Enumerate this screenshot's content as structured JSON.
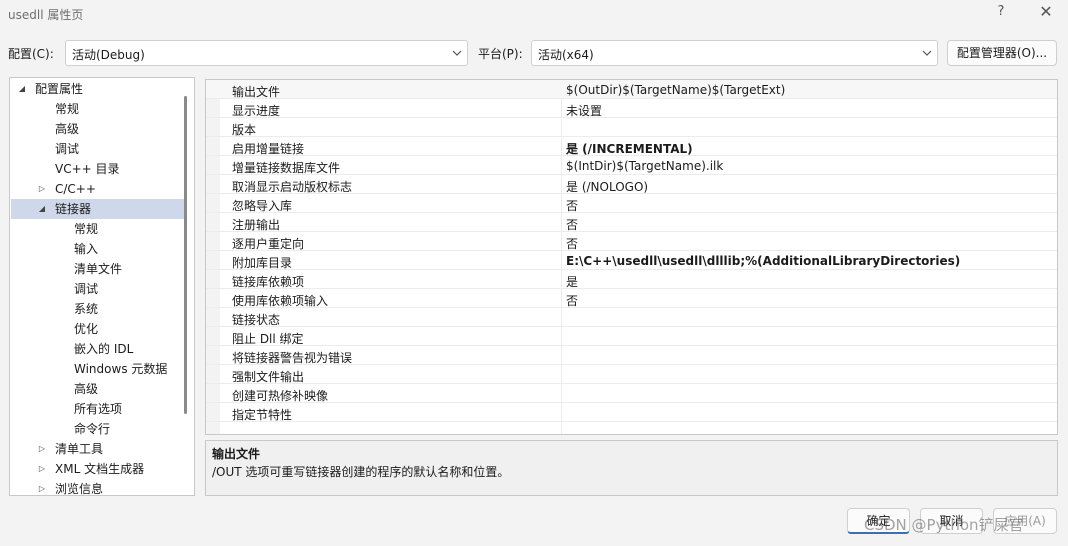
{
  "window": {
    "title": "usedll 属性页",
    "help_glyph": "?",
    "close_glyph": "✕"
  },
  "config_bar": {
    "config_label": "配置(C):",
    "config_value": "活动(Debug)",
    "platform_label": "平台(P):",
    "platform_value": "活动(x64)",
    "manager_button": "配置管理器(O)..."
  },
  "tree": {
    "items": [
      {
        "label": "配置属性",
        "expander": "◢",
        "level": 0
      },
      {
        "label": "常规",
        "expander": "",
        "level": 1
      },
      {
        "label": "高级",
        "expander": "",
        "level": 1
      },
      {
        "label": "调试",
        "expander": "",
        "level": 1
      },
      {
        "label": "VC++ 目录",
        "expander": "",
        "level": 1
      },
      {
        "label": "C/C++",
        "expander": "▷",
        "level": 1
      },
      {
        "label": "链接器",
        "expander": "◢",
        "level": 1,
        "selected": true
      },
      {
        "label": "常规",
        "expander": "",
        "level": 2
      },
      {
        "label": "输入",
        "expander": "",
        "level": 2
      },
      {
        "label": "清单文件",
        "expander": "",
        "level": 2
      },
      {
        "label": "调试",
        "expander": "",
        "level": 2
      },
      {
        "label": "系统",
        "expander": "",
        "level": 2
      },
      {
        "label": "优化",
        "expander": "",
        "level": 2
      },
      {
        "label": "嵌入的 IDL",
        "expander": "",
        "level": 2
      },
      {
        "label": "Windows 元数据",
        "expander": "",
        "level": 2
      },
      {
        "label": "高级",
        "expander": "",
        "level": 2
      },
      {
        "label": "所有选项",
        "expander": "",
        "level": 2
      },
      {
        "label": "命令行",
        "expander": "",
        "level": 2
      },
      {
        "label": "清单工具",
        "expander": "▷",
        "level": 1
      },
      {
        "label": "XML 文档生成器",
        "expander": "▷",
        "level": 1
      },
      {
        "label": "浏览信息",
        "expander": "▷",
        "level": 1
      }
    ]
  },
  "grid": {
    "rows": [
      {
        "name": "输出文件",
        "value": "$(OutDir)$(TargetName)$(TargetExt)",
        "bold": false
      },
      {
        "name": "显示进度",
        "value": "未设置",
        "bold": false
      },
      {
        "name": "版本",
        "value": "",
        "bold": false
      },
      {
        "name": "启用增量链接",
        "value": "是 (/INCREMENTAL)",
        "bold": true
      },
      {
        "name": "增量链接数据库文件",
        "value": "$(IntDir)$(TargetName).ilk",
        "bold": false
      },
      {
        "name": "取消显示启动版权标志",
        "value": "是 (/NOLOGO)",
        "bold": false
      },
      {
        "name": "忽略导入库",
        "value": "否",
        "bold": false
      },
      {
        "name": "注册输出",
        "value": "否",
        "bold": false
      },
      {
        "name": "逐用户重定向",
        "value": "否",
        "bold": false
      },
      {
        "name": "附加库目录",
        "value": "E:\\C++\\usedll\\usedll\\dlllib;%(AdditionalLibraryDirectories)",
        "bold": true
      },
      {
        "name": "链接库依赖项",
        "value": "是",
        "bold": false
      },
      {
        "name": "使用库依赖项输入",
        "value": "否",
        "bold": false
      },
      {
        "name": "链接状态",
        "value": "",
        "bold": false
      },
      {
        "name": "阻止 Dll 绑定",
        "value": "",
        "bold": false
      },
      {
        "name": "将链接器警告视为错误",
        "value": "",
        "bold": false
      },
      {
        "name": "强制文件输出",
        "value": "",
        "bold": false
      },
      {
        "name": "创建可热修补映像",
        "value": "",
        "bold": false
      },
      {
        "name": "指定节特性",
        "value": "",
        "bold": false
      }
    ]
  },
  "description": {
    "title": "输出文件",
    "text": "/OUT 选项可重写链接器创建的程序的默认名称和位置。"
  },
  "buttons": {
    "ok": "确定",
    "cancel": "取消",
    "apply": "应用(A)"
  },
  "watermark": "CSDN @Python铲屎官"
}
